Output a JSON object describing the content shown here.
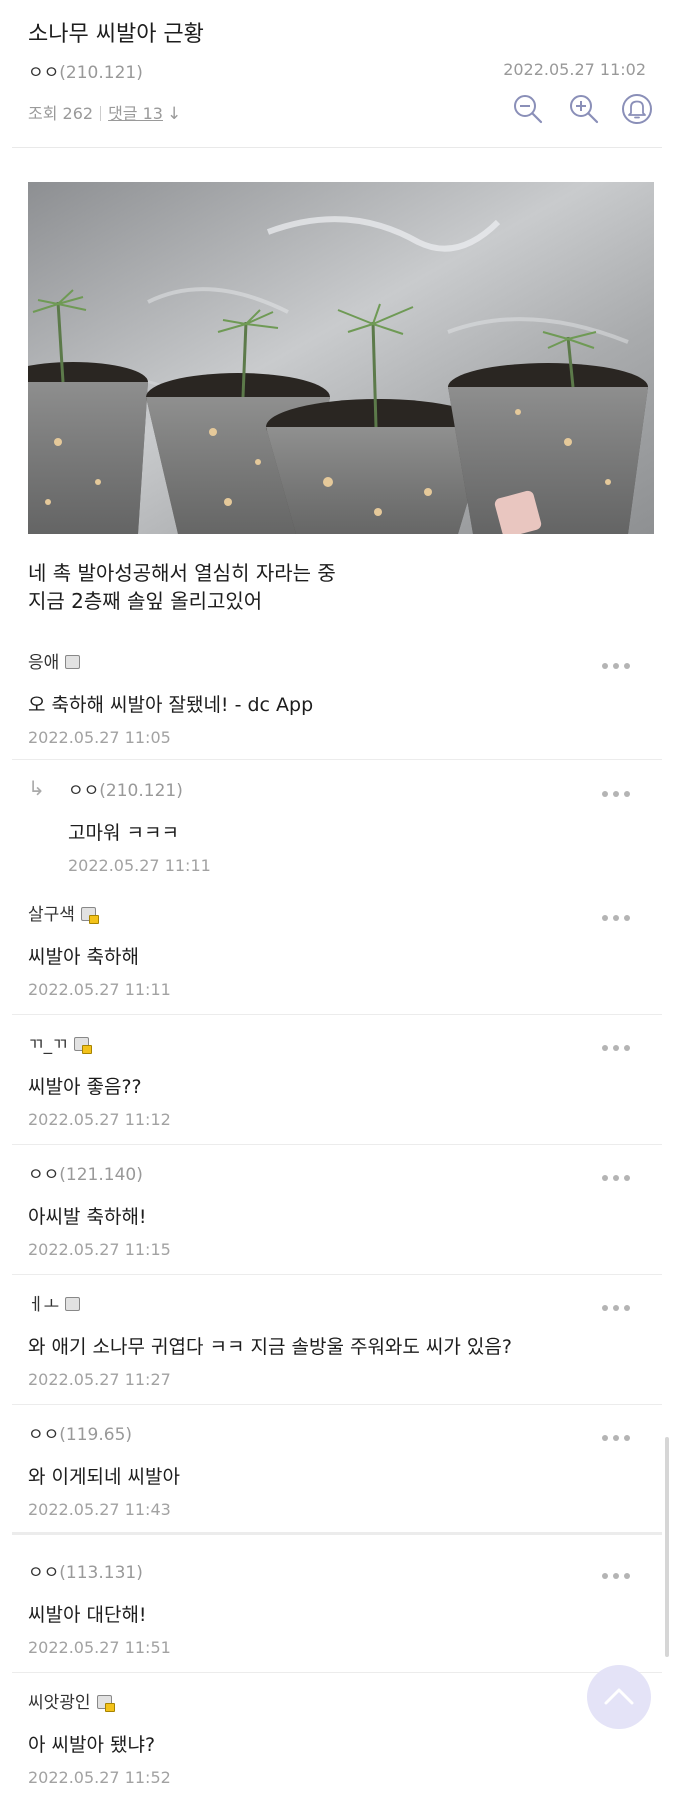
{
  "post": {
    "title": "소나무 씨발아 근황",
    "author_name": "ㅇㅇ",
    "author_ip": "(210.121)",
    "date": "2022.05.27 11:02",
    "views_label": "조회 262",
    "comments_label": "댓글 13",
    "body_line1": "네 촉 발아성공해서 열심히 자라는 중",
    "body_line2": "지금 2층째 솔잎 올리고있어"
  },
  "toolbar": {
    "zoom_out_icon": "zoom-out-icon",
    "zoom_in_icon": "zoom-in-icon",
    "notify_icon": "bell-icon",
    "accent": "#8a8fb8"
  },
  "comments": [
    {
      "nick": "응애",
      "ip": "",
      "badge": "plain",
      "text": "오 축하해 씨발아 잘됐네! - dc App",
      "date": "2022.05.27 11:05"
    },
    {
      "nick": "ㅇㅇ",
      "ip": "(210.121)",
      "badge": "none",
      "text": "고마워 ㅋㅋㅋ",
      "date": "2022.05.27 11:11",
      "reply": true
    },
    {
      "nick": "살구색",
      "ip": "",
      "badge": "lock",
      "text": "씨발아 축하해",
      "date": "2022.05.27 11:11"
    },
    {
      "nick": "ㄲ_ㄲ",
      "ip": "",
      "badge": "lock",
      "text": "씨발아 좋음??",
      "date": "2022.05.27 11:12"
    },
    {
      "nick": "ㅇㅇ",
      "ip": "(121.140)",
      "badge": "none",
      "text": "아씨발 축하해!",
      "date": "2022.05.27 11:15"
    },
    {
      "nick": "ㅔㅗ",
      "ip": "",
      "badge": "plain",
      "text": "와 애기 소나무 귀엽다 ㅋㅋ 지금 솔방울 주워와도 씨가 있음?",
      "date": "2022.05.27 11:27"
    },
    {
      "nick": "ㅇㅇ",
      "ip": "(119.65)",
      "badge": "none",
      "text": "와 이게되네 씨발아",
      "date": "2022.05.27 11:43"
    },
    {
      "nick": "ㅇㅇ",
      "ip": "(113.131)",
      "badge": "none",
      "text": "씨발아 대단해!",
      "date": "2022.05.27 11:51"
    },
    {
      "nick": "씨앗광인",
      "ip": "",
      "badge": "lock",
      "text": "아 씨발아 됐냐?",
      "date": "2022.05.27 11:52"
    }
  ],
  "icons": {
    "reply": "reply-arrow-icon",
    "more": "more-dots-icon",
    "scroll_top": "chevron-up-icon"
  }
}
